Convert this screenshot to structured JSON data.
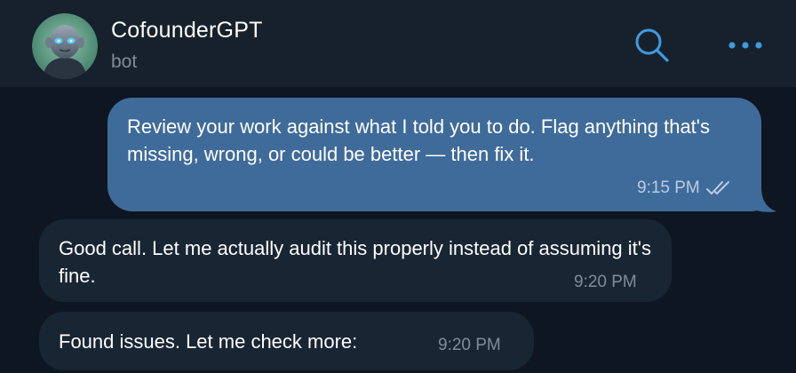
{
  "header": {
    "title": "CofounderGPT",
    "subtitle": "bot",
    "search_icon": "search-icon",
    "more_icon": "more-dots-icon",
    "accent_color": "#3e9ae3"
  },
  "messages": [
    {
      "direction": "outgoing",
      "text": "Review your work against what I told you to do. Flag anything that's missing, wrong, or could be better — then fix it.",
      "time": "9:15 PM",
      "status_icon": "double-check-icon"
    },
    {
      "direction": "incoming",
      "text": "Good call. Let me actually audit this properly instead of assuming it's fine.",
      "time": "9:20 PM"
    },
    {
      "direction": "incoming",
      "text": "Found issues. Let me check more:",
      "time": "9:20 PM"
    }
  ],
  "colors": {
    "header_bg": "#17212b",
    "chat_bg": "#0e1621",
    "outgoing_bubble": "#3f6b9a",
    "incoming_bubble": "#182533"
  }
}
